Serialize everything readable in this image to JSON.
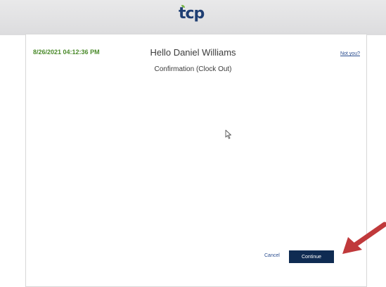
{
  "header": {
    "logo_text": "tcp",
    "brand_color": "#1f3f73",
    "leaf_color": "#7ab648"
  },
  "status": {
    "datetime": "8/26/2021 04:12:36 PM",
    "datetime_color": "#4a8a2a"
  },
  "main": {
    "greeting": "Hello Daniel Williams",
    "subtitle": "Confirmation (Clock Out)",
    "not_you_link": "Not you?"
  },
  "actions": {
    "cancel_label": "Cancel",
    "continue_label": "Continue",
    "continue_color": "#0f2b52"
  },
  "overlay": {
    "icon": "red-arrow-icon",
    "color": "#c0393b"
  },
  "cursor": {
    "icon": "mouse-pointer-icon"
  }
}
